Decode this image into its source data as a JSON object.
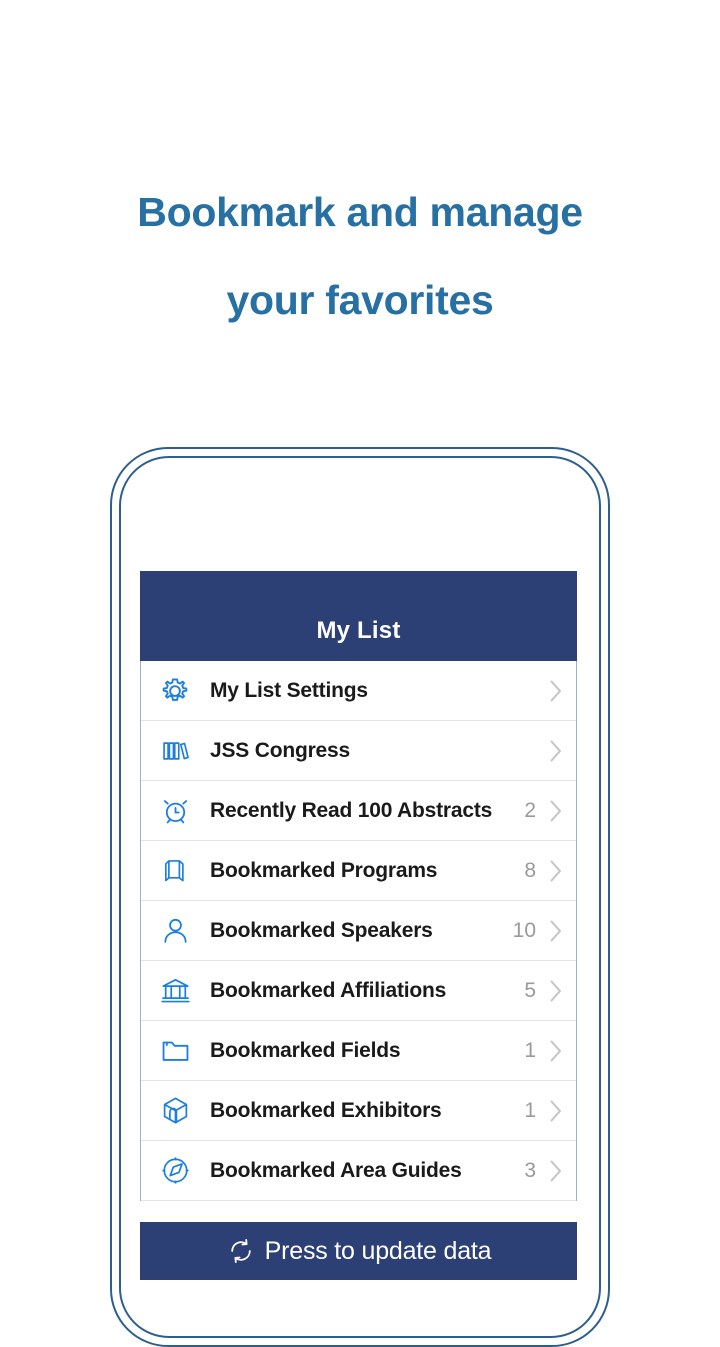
{
  "headline": {
    "line1": "Bookmark and manage",
    "line2": "your favorites",
    "color": "#2670a4"
  },
  "phone": {
    "frame_color": "#2c5f8f"
  },
  "app": {
    "header": {
      "title": "My List",
      "background": "#2c4076",
      "text_color": "#ffffff"
    },
    "accent_icon_color": "#1c7fe0",
    "list": [
      {
        "icon": "gear-icon",
        "label": "My List Settings",
        "count": ""
      },
      {
        "icon": "books-icon",
        "label": "JSS Congress",
        "count": ""
      },
      {
        "icon": "alarm-clock-icon",
        "label": "Recently Read 100 Abstracts",
        "count": "2"
      },
      {
        "icon": "book-icon",
        "label": "Bookmarked Programs",
        "count": "8"
      },
      {
        "icon": "person-icon",
        "label": "Bookmarked Speakers",
        "count": "10"
      },
      {
        "icon": "bank-icon",
        "label": "Bookmarked Affiliations",
        "count": "5"
      },
      {
        "icon": "folder-icon",
        "label": "Bookmarked Fields",
        "count": "1"
      },
      {
        "icon": "cube-icon",
        "label": "Bookmarked Exhibitors",
        "count": "1"
      },
      {
        "icon": "compass-icon",
        "label": "Bookmarked Area Guides",
        "count": "3"
      }
    ],
    "update_bar": {
      "icon": "refresh-icon",
      "label": "Press to update data",
      "background": "#2c4076"
    }
  }
}
